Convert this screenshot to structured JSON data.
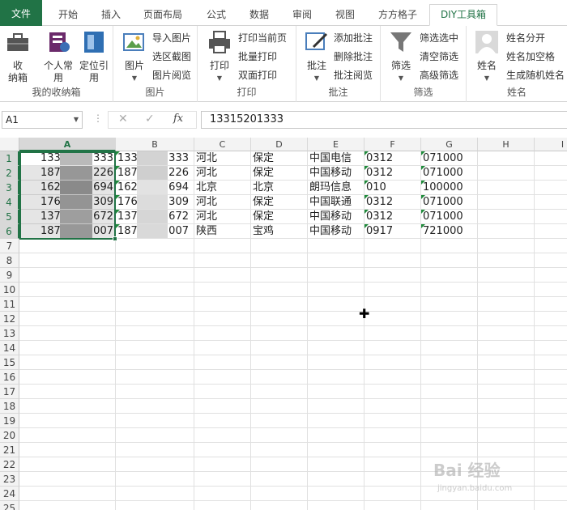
{
  "tabs": [
    "文件",
    "开始",
    "插入",
    "页面布局",
    "公式",
    "数据",
    "审阅",
    "视图",
    "方方格子",
    "DIY工具箱"
  ],
  "ribbon": {
    "group1": {
      "label": "我的收纳箱",
      "btn1": "收\n纳箱",
      "btn2": "个人常\n用",
      "btn3": "定位引\n用"
    },
    "group2": {
      "label": "图片",
      "big": "图片",
      "s1": "导入图片",
      "s2": "选区截图",
      "s3": "图片阅览"
    },
    "group3": {
      "label": "打印",
      "big": "打印",
      "s1": "打印当前页",
      "s2": "批量打印",
      "s3": "双面打印"
    },
    "group4": {
      "label": "批注",
      "big": "批注",
      "s1": "添加批注",
      "s2": "删除批注",
      "s3": "批注阅览"
    },
    "group5": {
      "label": "筛选",
      "big": "筛选",
      "s1": "筛选选中",
      "s2": "清空筛选",
      "s3": "高级筛选"
    },
    "group6": {
      "label": "姓名",
      "big": "姓名",
      "s1": "姓名分开",
      "s2": "姓名加空格",
      "s3": "生成随机姓名"
    }
  },
  "formula_bar": {
    "name_box": "A1",
    "value": "13315201333",
    "fx": "fx"
  },
  "columns": [
    "A",
    "B",
    "C",
    "D",
    "E",
    "F",
    "G",
    "H",
    "I"
  ],
  "rows": [
    "1",
    "2",
    "3",
    "4",
    "5",
    "6",
    "7",
    "8",
    "9",
    "10",
    "11",
    "12",
    "13",
    "14",
    "15",
    "16",
    "17",
    "18",
    "19",
    "20",
    "21",
    "22",
    "23",
    "24",
    "25"
  ],
  "cells": [
    {
      "a_l": "133",
      "a_r": "333",
      "b_l": "133",
      "b_r": "333",
      "c": "河北",
      "d": "保定",
      "e": "中国电信",
      "f": "0312",
      "g": "071000"
    },
    {
      "a_l": "187",
      "a_r": "226",
      "b_l": "187",
      "b_r": "226",
      "c": "河北",
      "d": "保定",
      "e": "中国移动",
      "f": "0312",
      "g": "071000"
    },
    {
      "a_l": "162",
      "a_r": "694",
      "b_l": "162",
      "b_r": "694",
      "c": "北京",
      "d": "北京",
      "e": "朗玛信息",
      "f": "010",
      "g": "100000"
    },
    {
      "a_l": "176",
      "a_r": "309",
      "b_l": "176",
      "b_r": "309",
      "c": "河北",
      "d": "保定",
      "e": "中国联通",
      "f": "0312",
      "g": "071000"
    },
    {
      "a_l": "137",
      "a_r": "672",
      "b_l": "137",
      "b_r": "672",
      "c": "河北",
      "d": "保定",
      "e": "中国移动",
      "f": "0312",
      "g": "071000"
    },
    {
      "a_l": "187",
      "a_r": "007",
      "b_l": "187",
      "b_r": "007",
      "c": "陕西",
      "d": "宝鸡",
      "e": "中国移动",
      "f": "0917",
      "g": "721000"
    }
  ],
  "watermark": {
    "main": "Bai 经验",
    "sub": "jingyan.baidu.com"
  }
}
